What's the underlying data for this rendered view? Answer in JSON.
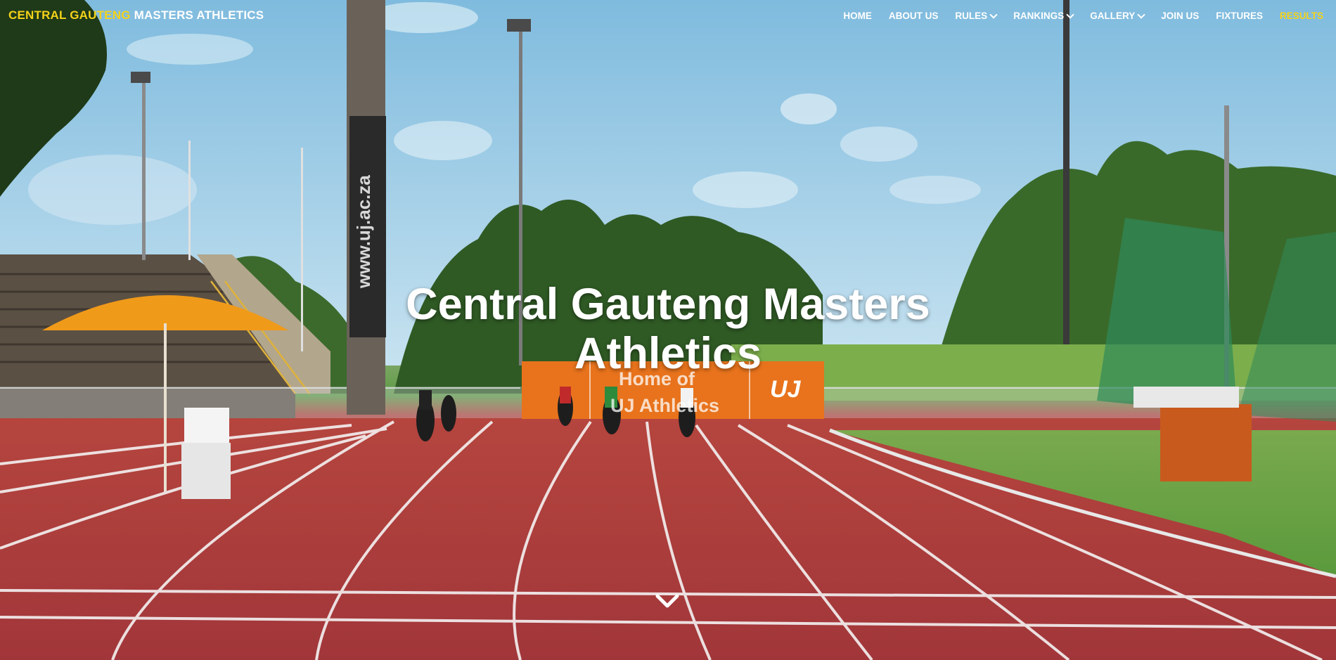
{
  "brand": {
    "part1": "CENTRAL GAUTENG",
    "part2": "MASTERS ATHLETICS"
  },
  "nav": {
    "items": [
      {
        "label": "HOME",
        "dropdown": false,
        "active": false
      },
      {
        "label": "ABOUT US",
        "dropdown": false,
        "active": false
      },
      {
        "label": "RULES",
        "dropdown": true,
        "active": false
      },
      {
        "label": "RANKINGS",
        "dropdown": true,
        "active": false
      },
      {
        "label": "GALLERY",
        "dropdown": true,
        "active": false
      },
      {
        "label": "JOIN US",
        "dropdown": false,
        "active": false
      },
      {
        "label": "FIXTURES",
        "dropdown": false,
        "active": false
      },
      {
        "label": "RESULTS",
        "dropdown": false,
        "active": true
      }
    ]
  },
  "hero": {
    "title": "Central Gauteng Masters Athletics",
    "pole_text": "www.uj.ac.za",
    "banner_text_1": "Home of",
    "banner_text_2": "UJ Athletics",
    "banner_logo": "UJ",
    "scroll_icon": "chevron-down-icon"
  },
  "colors": {
    "brand_accent": "#f4d31a",
    "nav_text": "#ffffff",
    "track": "#a8383a",
    "grass": "#5e9a45",
    "sky": "#8cc3e0",
    "banner": "#e8731c"
  }
}
